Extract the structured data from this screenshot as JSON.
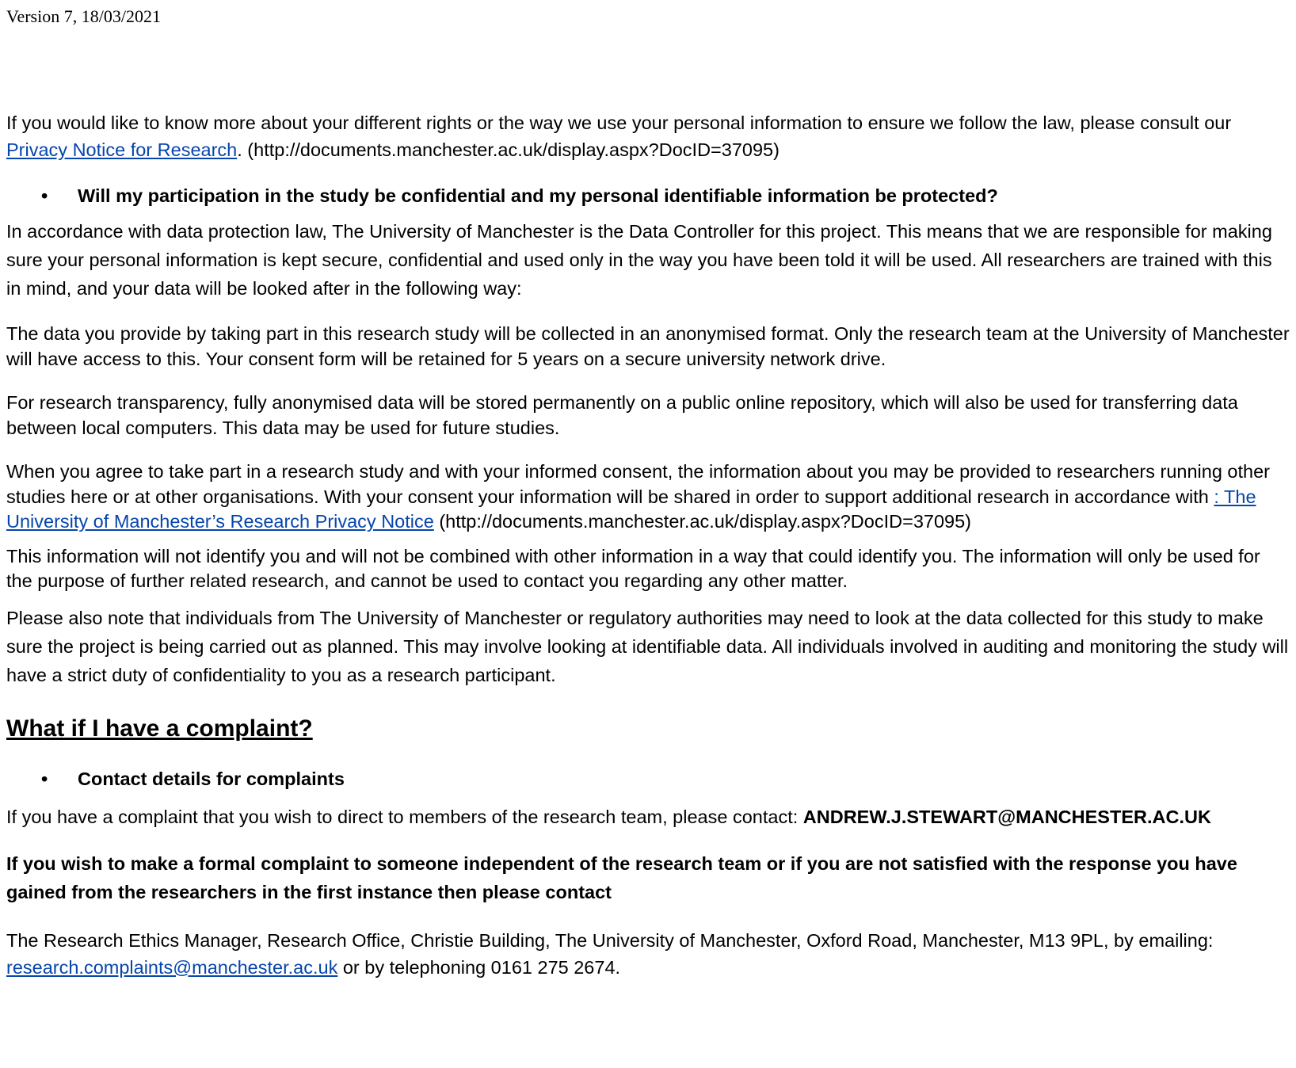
{
  "header": {
    "version": "Version 7, 18/03/2021"
  },
  "section1": {
    "intro_text": "If you would like to know more about your different rights or the way we use your personal information to ensure we follow the law, please consult our ",
    "privacy_link": "Privacy Notice for Research",
    "intro_suffix": ". (http://documents.manchester.ac.uk/display.aspx?DocID=37095)",
    "bullet_symbol": "•",
    "bullet_question": "Will my participation in the study be confidential and my personal identifiable information be protected?",
    "para_controller": "In accordance with data protection law, The University of Manchester is the Data Controller for this project. This means that we are responsible for making sure your personal information is kept secure, confidential and used only in the way you have been told it will be used. All researchers are trained with this in mind, and your data will be looked after in the following way:",
    "para_anonymised": "The data you provide by taking part in this research study will be collected in an anonymised format. Only the research team at the University of Manchester will have access to this. Your consent form will be retained for 5 years on a secure university network drive.",
    "para_transparency": "For research transparency, fully anonymised data will be stored permanently on a public online repository, which will also be used for transferring data between local computers. This data may be used for future studies.",
    "para_sharing": "When you agree to take part in a research study and with your informed consent, the information about you may be provided to researchers running other studies here or at other organisations. With your consent your information will be shared in order to support additional research in accordance with ",
    "sharing_link": ": The University of Manchester’s Research Privacy Notice",
    "sharing_suffix": " (http://documents.manchester.ac.uk/display.aspx?DocID=37095)",
    "para_identify": "This information will not identify you and will not be combined with other information in a way that could identify you. The information will only be used for the purpose of further related research, and cannot be used to contact you regarding any other matter.",
    "para_audit": "Please also note that individuals from The University of Manchester or regulatory authorities may need to look at the data collected for this study to make sure the project is being carried out as planned. This may involve looking at identifiable data.  All individuals involved in auditing and monitoring the study will have a strict duty of confidentiality to you as a research participant."
  },
  "section2": {
    "heading": "What if I have a complaint?",
    "bullet_symbol": "•",
    "bullet_label": "Contact details for complaints",
    "contact_text": "If you have a complaint that you wish to direct to members of the research team, please contact:  ",
    "contact_email": "ANDREW.J.STEWART@MANCHESTER.AC.UK",
    "formal_complaint": "If you wish to make a formal complaint to someone independent of the research team or if you are not satisfied with the response you have gained from the researchers in the first instance then please contact",
    "ethics_text": "The Research Ethics Manager, Research Office, Christie Building, The University of Manchester, Oxford Road, Manchester, M13 9PL, by emailing: ",
    "ethics_email": "research.complaints@manchester.ac.uk",
    "ethics_suffix": "  or by telephoning 0161 275 2674."
  }
}
